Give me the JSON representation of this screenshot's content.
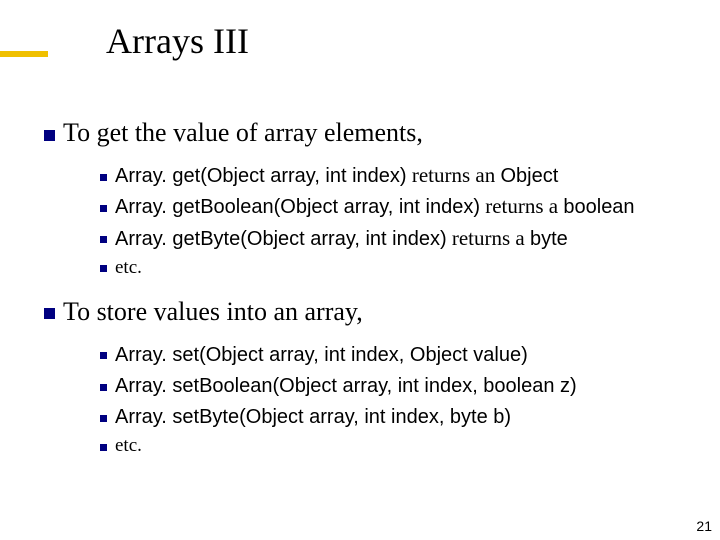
{
  "title": "Arrays III",
  "section1": {
    "heading": "To get the value of array elements,",
    "items": [
      {
        "code": "Array. get(Object array, int index)",
        "mid": " returns an ",
        "tail": "Object"
      },
      {
        "code": "Array. getBoolean(Object array, int index)",
        "mid": " returns a ",
        "tail": "boolean"
      },
      {
        "code": "Array. getByte(Object array, int index)",
        "mid": " returns a ",
        "tail": "byte"
      }
    ],
    "etc": "etc."
  },
  "section2": {
    "heading": "To store values into an array,",
    "items": [
      {
        "code": "Array. set(Object array, int index, Object value)"
      },
      {
        "code": "Array. setBoolean(Object array, int index, boolean z)"
      },
      {
        "code": "Array. setByte(Object array, int index, byte b)"
      }
    ],
    "etc": "etc."
  },
  "page": "21"
}
